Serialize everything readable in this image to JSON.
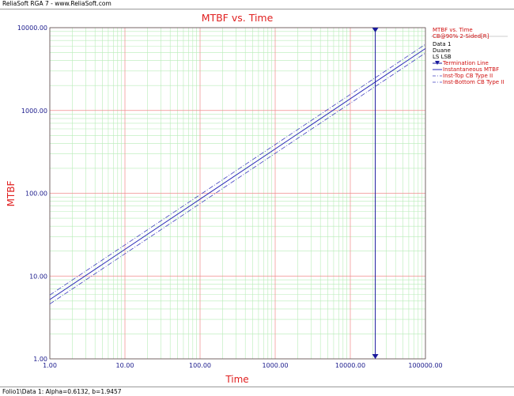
{
  "window_title": "ReliaSoft RGA 7 - www.ReliaSoft.com",
  "status_text": "Folio1\\Data 1: Alpha=0.6132, b=1.9457",
  "legend": {
    "title": "MTBF vs. Time",
    "subtitle": "CB@90% 2-Sided[R]",
    "data_name": "Data 1",
    "model": "Duane",
    "method": "LS LSB",
    "items": [
      {
        "label": "Termination Line",
        "color": "#1a1a9c",
        "style": "marker"
      },
      {
        "label": "Instantaneous MTBF",
        "color": "#2a2ab8",
        "style": "solid"
      },
      {
        "label": "Inst-Top CB Type II",
        "color": "#4040c0",
        "style": "dashdot"
      },
      {
        "label": "Inst-Bottom CB Type II",
        "color": "#4040c0",
        "style": "dashdot"
      }
    ]
  },
  "chart_data": {
    "type": "line",
    "title": "MTBF vs. Time",
    "xlabel": "Time",
    "ylabel": "MTBF",
    "xscale": "log",
    "yscale": "log",
    "xlim": [
      1,
      100000
    ],
    "ylim": [
      1,
      10000
    ],
    "xticks": [
      "1.00",
      "10.00",
      "100.00",
      "1000.00",
      "10000.00",
      "100000.00"
    ],
    "yticks": [
      "1.00",
      "10.00",
      "100.00",
      "1000.00",
      "10000.00"
    ],
    "termination_time": 21500,
    "series": [
      {
        "name": "Instantaneous MTBF",
        "x": [
          1,
          100000
        ],
        "y": [
          5.2,
          5600
        ],
        "color": "#2a2ab8",
        "style": "solid"
      },
      {
        "name": "Inst-Top CB Type II",
        "x": [
          1,
          100000
        ],
        "y": [
          5.9,
          6300
        ],
        "color": "#4040c0",
        "style": "dashdot"
      },
      {
        "name": "Inst-Bottom CB Type II",
        "x": [
          1,
          100000
        ],
        "y": [
          4.6,
          4950
        ],
        "color": "#4040c0",
        "style": "dashdot"
      }
    ],
    "colors": {
      "title": "#e02020",
      "axis_label": "#e02020",
      "tick": "#1a1a8c",
      "major_grid": "#f08c8c",
      "minor_grid": "#b8ecb8"
    }
  }
}
